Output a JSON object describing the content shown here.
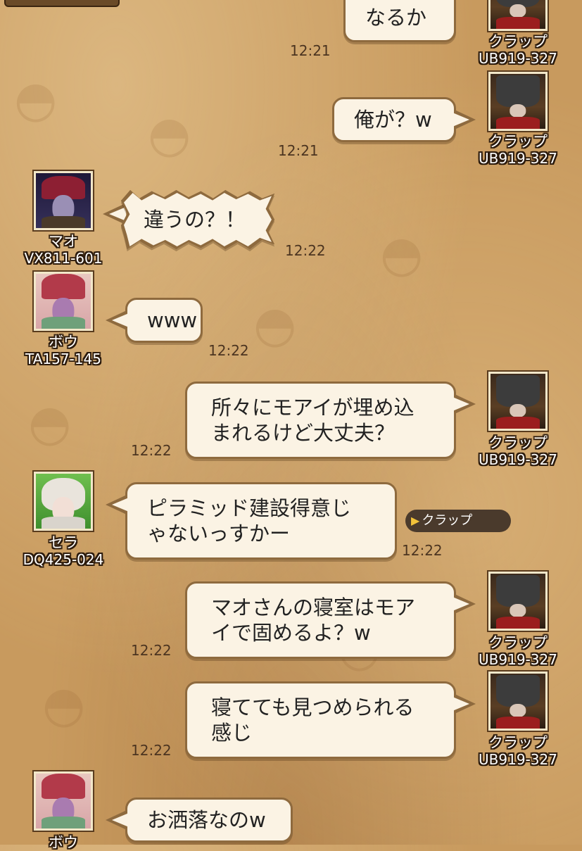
{
  "messages": [
    {
      "text": "なるか",
      "time": "12:21",
      "sender": "クラップ",
      "id": "UB919-327"
    },
    {
      "text": "俺が？w",
      "time": "12:21",
      "sender": "クラップ",
      "id": "UB919-327"
    },
    {
      "text": "違うの？！",
      "time": "12:22",
      "sender": "マオ",
      "id": "VX811-601"
    },
    {
      "text": "www",
      "time": "12:22",
      "sender": "ボウ",
      "id": "TA157-145"
    },
    {
      "text": "所々にモアイが埋め込まれるけど大丈夫？",
      "line1": "所々にモアイが埋め込",
      "line2": "まれるけど大丈夫？",
      "time": "12:22",
      "sender": "クラップ",
      "id": "UB919-327"
    },
    {
      "line1": "ピラミッド建設得意じ",
      "line2": "ゃないっすかー",
      "time": "12:22",
      "sender": "セラ",
      "id": "DQ425-024",
      "mention": "クラップ"
    },
    {
      "line1": "マオさんの寝室はモア",
      "line2": "イで固めるよ？w",
      "time": "12:22",
      "sender": "クラップ",
      "id": "UB919-327"
    },
    {
      "line1": "寝てても見つめられる",
      "line2": "感じ",
      "time": "12:22",
      "sender": "クラップ",
      "id": "UB919-327"
    },
    {
      "text": "お洒落なのw",
      "sender": "ボウ"
    }
  ],
  "icons": {
    "mention_arrow": "play-triangle-icon"
  }
}
